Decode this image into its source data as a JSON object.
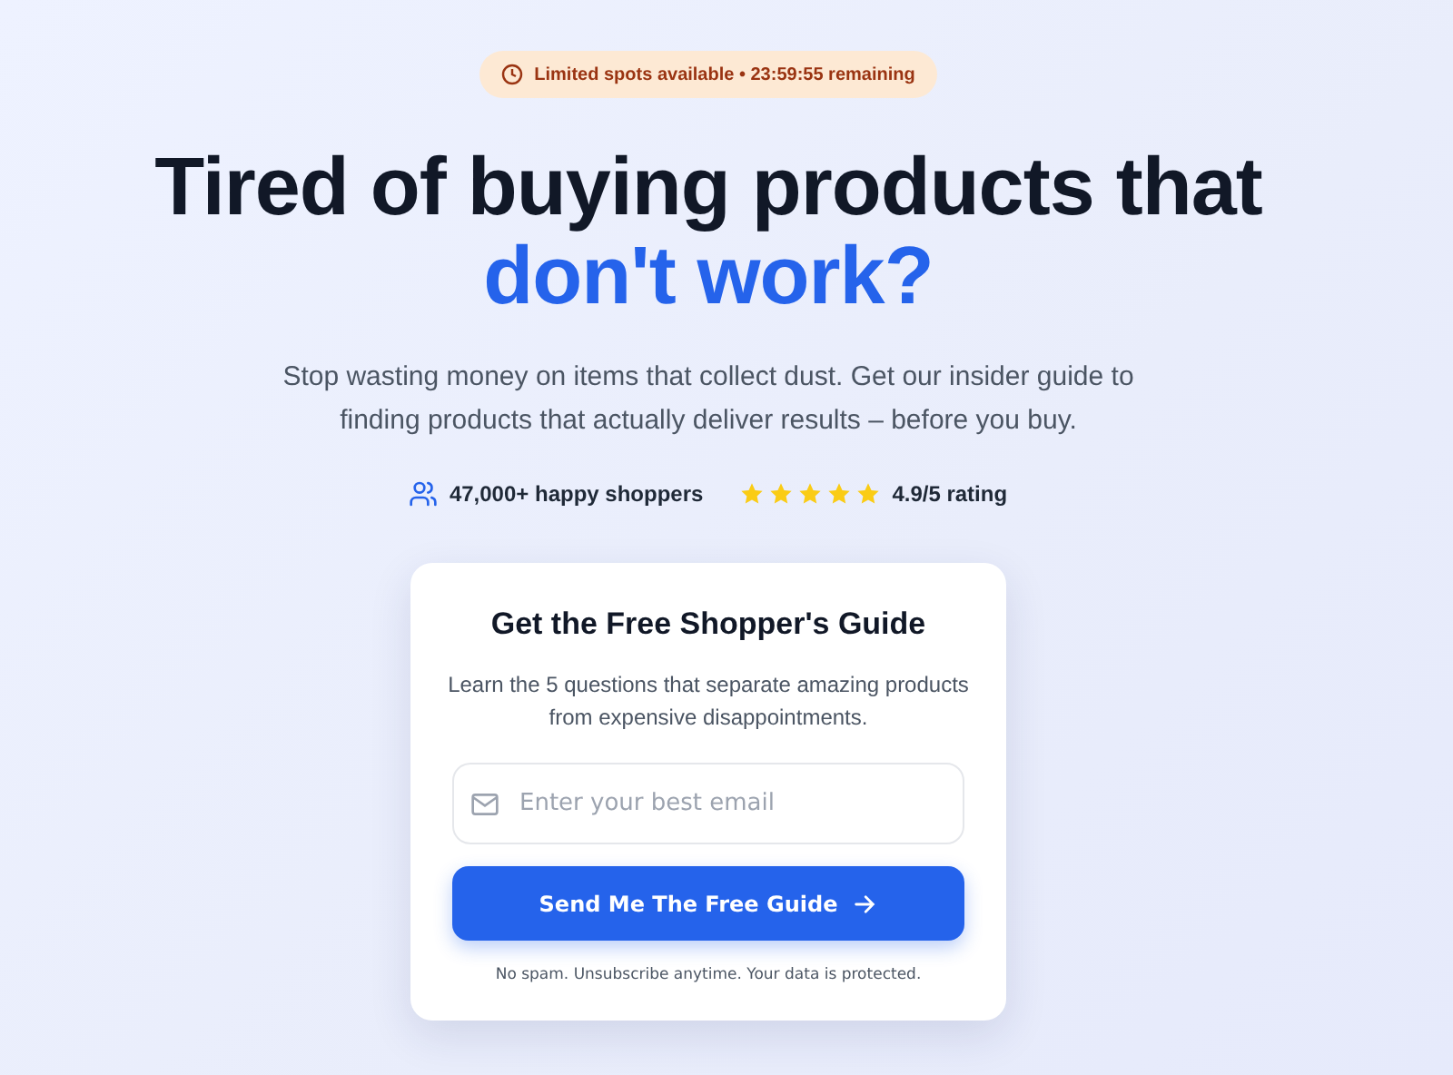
{
  "badge": {
    "text": "Limited spots available • 23:59:55 remaining"
  },
  "headline": {
    "line_1": "Tired of buying products that",
    "line_2": "don't work?"
  },
  "subtitle": "Stop wasting money on items that collect dust. Get our insider guide to finding products that actually deliver results – before you buy.",
  "stats": {
    "shoppers": "47,000+ happy shoppers",
    "stars": 5,
    "rating": "4.9/5 rating"
  },
  "card": {
    "title": "Get the Free Shopper's Guide",
    "description": "Learn the 5 questions that separate amazing products from expensive disappointments.",
    "email": {
      "placeholder": "Enter your best email"
    },
    "button": "Send Me The Free Guide",
    "note": "No spam. Unsubscribe anytime. Your data is protected."
  }
}
